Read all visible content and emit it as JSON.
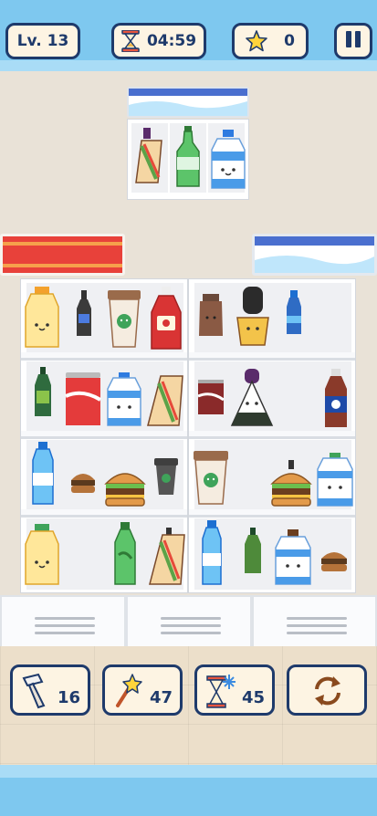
{
  "hud": {
    "level_label": "Lv. 13",
    "timer": "04:59",
    "stars": "0"
  },
  "tools": [
    {
      "name": "hammer",
      "count": "16"
    },
    {
      "name": "magic-wand",
      "count": "47"
    },
    {
      "name": "freeze-time",
      "count": "45"
    },
    {
      "name": "shuffle",
      "count": ""
    }
  ],
  "colors": {
    "outline": "#1e3a6b",
    "sky": "#7ec8ef",
    "panel": "#fdf4e3",
    "star": "#ffd43b"
  },
  "shelves": {
    "top_display": [
      "sandwich",
      "green-soda",
      "milk-bottle"
    ],
    "left_cabinet": [
      [
        "orange-juice",
        "dark-bottle",
        "coffee-cup",
        "ketchup"
      ],
      [
        "green-bottle",
        "cola-can",
        "milk-bottle",
        "sandwich"
      ],
      [
        "water-bottle",
        "burger-small",
        "burger",
        "coffee-small"
      ],
      [
        "orange-juice",
        "green-soda",
        "sandwich"
      ]
    ],
    "right_cabinet": [
      [
        "coffee-jar",
        "pudding",
        "water-small"
      ],
      [
        "cola-can",
        "onigiri",
        "cola-bottle"
      ],
      [
        "coffee-cup",
        "burger",
        "milk-bottle"
      ],
      [
        "water-bottle",
        "green-bottle",
        "milk-bottle",
        "burger-small"
      ]
    ]
  }
}
